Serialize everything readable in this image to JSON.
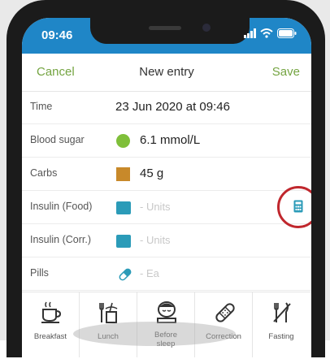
{
  "status_bar": {
    "time": "09:46"
  },
  "nav": {
    "cancel": "Cancel",
    "title": "New entry",
    "save": "Save"
  },
  "rows": [
    {
      "label": "Time",
      "value": "23 Jun 2020 at 09:46"
    },
    {
      "label": "Blood sugar",
      "value": "6.1 mmol/L",
      "icon": "green-circle-icon",
      "color": "#7fbf3a"
    },
    {
      "label": "Carbs",
      "value": "45 g",
      "icon": "orange-square-icon",
      "color": "#c8892a"
    },
    {
      "label": "Insulin (Food)",
      "placeholder": "- Units",
      "icon": "insulin-pen-icon",
      "accessory": "calculator-icon"
    },
    {
      "label": "Insulin (Corr.)",
      "placeholder": "- Units",
      "icon": "insulin-pen-icon"
    },
    {
      "label": "Pills",
      "placeholder": "- Ea",
      "icon": "pill-icon"
    }
  ],
  "actions": [
    {
      "label": "Breakfast",
      "icon": "coffee-cup-icon"
    },
    {
      "label": "Lunch",
      "icon": "lunch-icon"
    },
    {
      "label": "Before",
      "sublabel": "sleep",
      "icon": "sleeping-face-icon"
    },
    {
      "label": "Correction",
      "icon": "bandage-icon"
    },
    {
      "label": "Fasting",
      "icon": "no-food-icon"
    }
  ],
  "colors": {
    "accent_green": "#74a441",
    "status_blue": "#1f86c7",
    "highlight_red": "#c0272d",
    "insulin_teal": "#2b9bb8"
  }
}
